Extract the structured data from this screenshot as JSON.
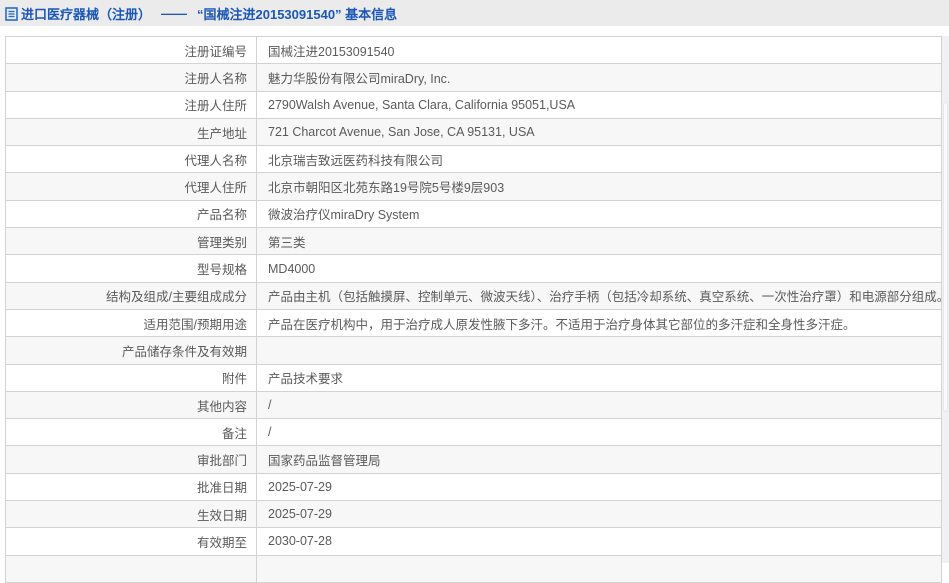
{
  "header": {
    "title_left": "进口医疗器械（注册）",
    "title_dash": "——",
    "title_right": "“国械注进20153091540” 基本信息"
  },
  "table": {
    "rows": [
      {
        "label": "注册证编号",
        "value": "国械注进20153091540"
      },
      {
        "label": "注册人名称",
        "value": "魅力华股份有限公司miraDry, Inc."
      },
      {
        "label": "注册人住所",
        "value": "2790Walsh Avenue, Santa Clara, California 95051,USA"
      },
      {
        "label": "生产地址",
        "value": "721 Charcot Avenue, San Jose, CA 95131, USA"
      },
      {
        "label": "代理人名称",
        "value": "北京瑞吉致远医药科技有限公司"
      },
      {
        "label": "代理人住所",
        "value": "北京市朝阳区北苑东路19号院5号楼9层903"
      },
      {
        "label": "产品名称",
        "value": "微波治疗仪miraDry System"
      },
      {
        "label": "管理类别",
        "value": "第三类"
      },
      {
        "label": "型号规格",
        "value": "MD4000"
      },
      {
        "label": "结构及组成/主要组成成分",
        "value": "产品由主机（包括触摸屏、控制单元、微波天线）、治疗手柄（包括冷却系统、真空系统、一次性治疗罩）和电源部分组成。"
      },
      {
        "label": "适用范围/预期用途",
        "value": "产品在医疗机构中，用于治疗成人原发性腋下多汗。不适用于治疗身体其它部位的多汗症和全身性多汗症。"
      },
      {
        "label": "产品储存条件及有效期",
        "value": ""
      },
      {
        "label": "附件",
        "value": "产品技术要求"
      },
      {
        "label": "其他内容",
        "value": "/"
      },
      {
        "label": "备注",
        "value": "/"
      },
      {
        "label": "审批部门",
        "value": "国家药品监督管理局"
      },
      {
        "label": "批准日期",
        "value": "2025-07-29"
      },
      {
        "label": "生效日期",
        "value": "2025-07-29"
      },
      {
        "label": "有效期至",
        "value": "2030-07-28"
      },
      {
        "label": "",
        "value": ""
      }
    ]
  },
  "colors": {
    "title_blue": "#1a57b8",
    "header_bg": "#ebebeb",
    "border": "#d3d3d3",
    "row_alt_bg": "#f7f7f7",
    "text": "#5a5a5a"
  }
}
